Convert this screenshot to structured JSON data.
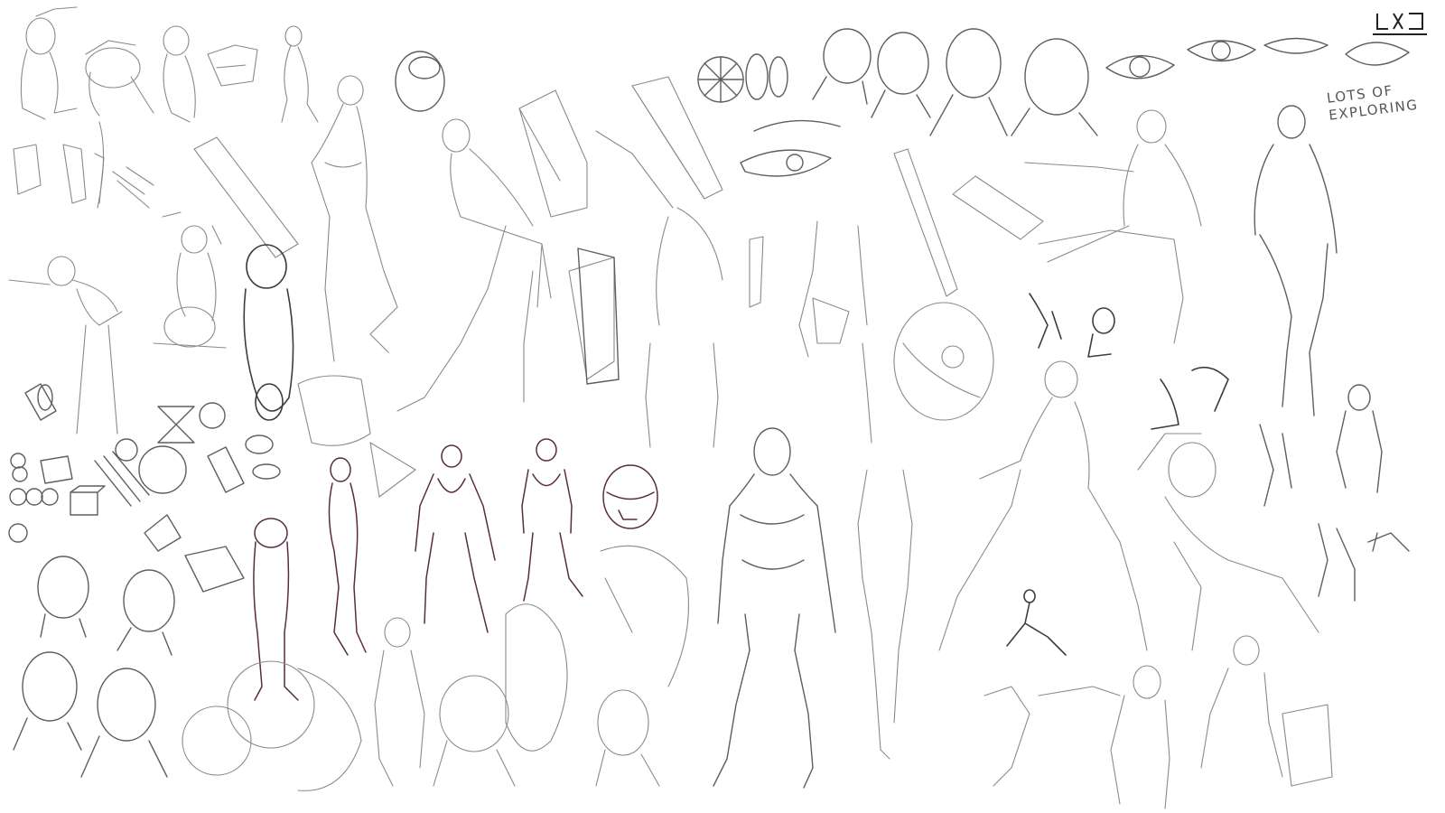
{
  "annotation": {
    "line1": "LOTS OF",
    "line2": "EXPLORING"
  },
  "logo": {
    "text": ""
  },
  "colors": {
    "paper": "#ffffff",
    "pencil": "#8a8a8a",
    "dark_pencil": "#3d3d3d",
    "accent_purple": "#5a2a45"
  }
}
